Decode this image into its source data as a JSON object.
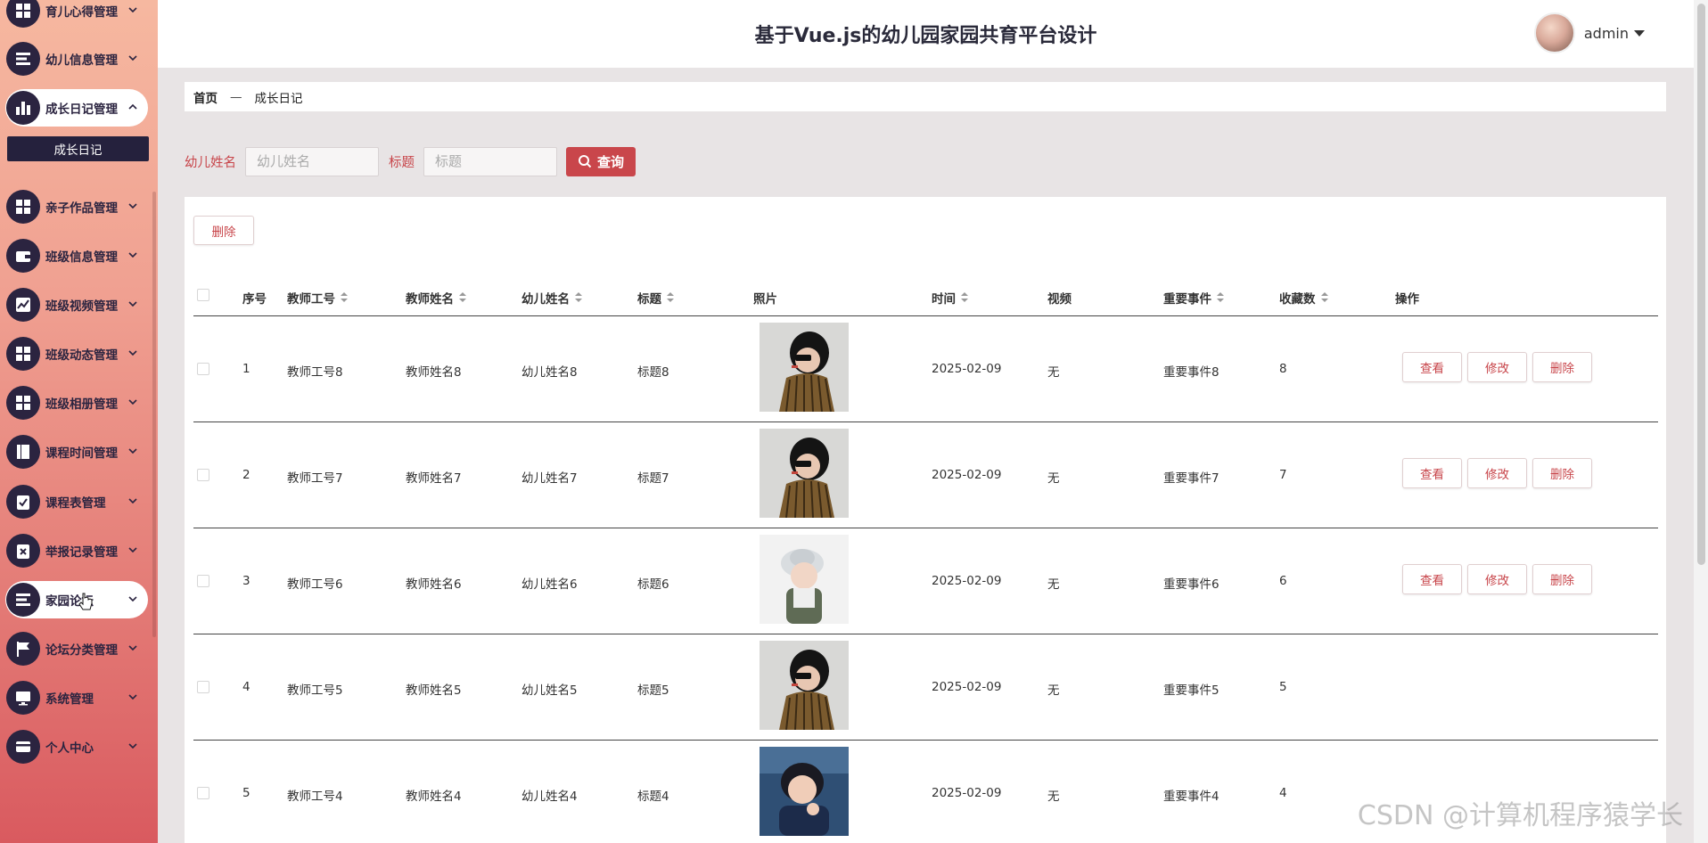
{
  "header": {
    "title": "基于Vue.js的幼儿园家园共育平台设计",
    "username": "admin"
  },
  "sidebar": {
    "items": [
      {
        "label": "育儿心得管理",
        "icon": "grid-icon"
      },
      {
        "label": "幼儿信息管理",
        "icon": "list-icon"
      },
      {
        "label": "成长日记管理",
        "icon": "bar-chart-icon",
        "expanded": true
      },
      {
        "label": "亲子作品管理",
        "icon": "grid-icon"
      },
      {
        "label": "班级信息管理",
        "icon": "wallet-icon"
      },
      {
        "label": "班级视频管理",
        "icon": "line-chart-icon"
      },
      {
        "label": "班级动态管理",
        "icon": "grid-icon"
      },
      {
        "label": "班级相册管理",
        "icon": "grid-icon"
      },
      {
        "label": "课程时间管理",
        "icon": "book-icon"
      },
      {
        "label": "课程表管理",
        "icon": "clipboard-check-icon"
      },
      {
        "label": "举报记录管理",
        "icon": "clipboard-x-icon"
      },
      {
        "label": "家园论坛",
        "icon": "list-icon",
        "hovered": true
      },
      {
        "label": "论坛分类管理",
        "icon": "flag-icon"
      },
      {
        "label": "系统管理",
        "icon": "monitor-icon"
      },
      {
        "label": "个人中心",
        "icon": "card-icon"
      }
    ],
    "submenu": {
      "label": "成长日记"
    }
  },
  "breadcrumb": {
    "home": "首页",
    "separator": "—",
    "current": "成长日记"
  },
  "search": {
    "child_label": "幼儿姓名",
    "child_placeholder": "幼儿姓名",
    "title_label": "标题",
    "title_placeholder": "标题",
    "button": "查询"
  },
  "toolbar": {
    "delete_label": "删除"
  },
  "table": {
    "headers": {
      "index": "序号",
      "teacher_no": "教师工号",
      "teacher_name": "教师姓名",
      "child_name": "幼儿姓名",
      "title": "标题",
      "photo": "照片",
      "time": "时间",
      "video": "视频",
      "event": "重要事件",
      "favorites": "收藏数",
      "actions": "操作"
    },
    "action_labels": {
      "view": "查看",
      "edit": "修改",
      "delete": "删除"
    },
    "rows": [
      {
        "index": "1",
        "teacher_no": "教师工号8",
        "teacher_name": "教师姓名8",
        "child_name": "幼儿姓名8",
        "title": "标题8",
        "time": "2025-02-09",
        "video": "无",
        "event": "重要事件8",
        "favorites": "8",
        "photo": "girl-striped"
      },
      {
        "index": "2",
        "teacher_no": "教师工号7",
        "teacher_name": "教师姓名7",
        "child_name": "幼儿姓名7",
        "title": "标题7",
        "time": "2025-02-09",
        "video": "无",
        "event": "重要事件7",
        "favorites": "7",
        "photo": "girl-striped"
      },
      {
        "index": "3",
        "teacher_no": "教师工号6",
        "teacher_name": "教师姓名6",
        "child_name": "幼儿姓名6",
        "title": "标题6",
        "time": "2025-02-09",
        "video": "无",
        "event": "重要事件6",
        "favorites": "6",
        "photo": "girl-hat"
      },
      {
        "index": "4",
        "teacher_no": "教师工号5",
        "teacher_name": "教师姓名5",
        "child_name": "幼儿姓名5",
        "title": "标题5",
        "time": "2025-02-09",
        "video": "无",
        "event": "重要事件5",
        "favorites": "5",
        "photo": "girl-striped"
      },
      {
        "index": "5",
        "teacher_no": "教师工号4",
        "teacher_name": "教师姓名4",
        "child_name": "幼儿姓名4",
        "title": "标题4",
        "time": "2025-02-09",
        "video": "无",
        "event": "重要事件4",
        "favorites": "4",
        "photo": "girl-blue"
      }
    ]
  },
  "watermark": "CSDN @计算机程序猿学长",
  "colors": {
    "accent": "#c9464b",
    "sidebar_dark": "#2b2440"
  }
}
